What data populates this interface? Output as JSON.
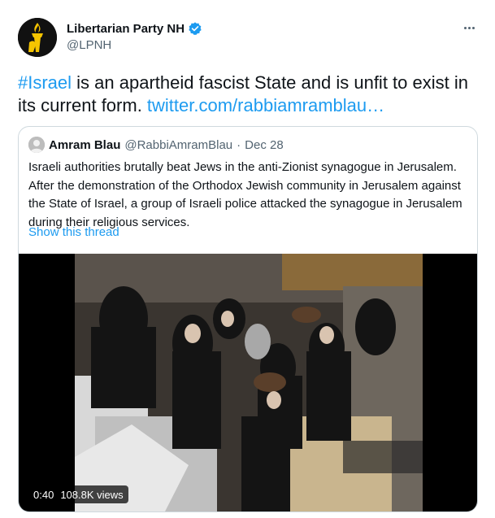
{
  "author": {
    "name": "Libertarian Party NH",
    "handle": "@LPNH"
  },
  "tweet": {
    "hashtag": "#Israel",
    "text": " is an apartheid fascist State and is unfit to exist in its current form. ",
    "link": "twitter.com/rabbiamramblau…"
  },
  "quoted": {
    "name": "Amram Blau",
    "handle": "@RabbiAmramBlau",
    "separator": " · ",
    "date": "Dec 28",
    "text": "Israeli authorities brutally beat Jews in the anti-Zionist synagogue in Jerusalem. After the demonstration of the Orthodox Jewish community in Jerusalem against the State of Israel, a group of Israeli police attacked the synagogue in Jerusalem during their religious services.",
    "show_thread": "Show this thread",
    "video": {
      "duration": "0:40",
      "views": "108.8K views"
    }
  },
  "colors": {
    "link": "#1d9bf0",
    "secondary_text": "#536471",
    "border": "#cfd9de",
    "verified": "#1d9bf0"
  }
}
